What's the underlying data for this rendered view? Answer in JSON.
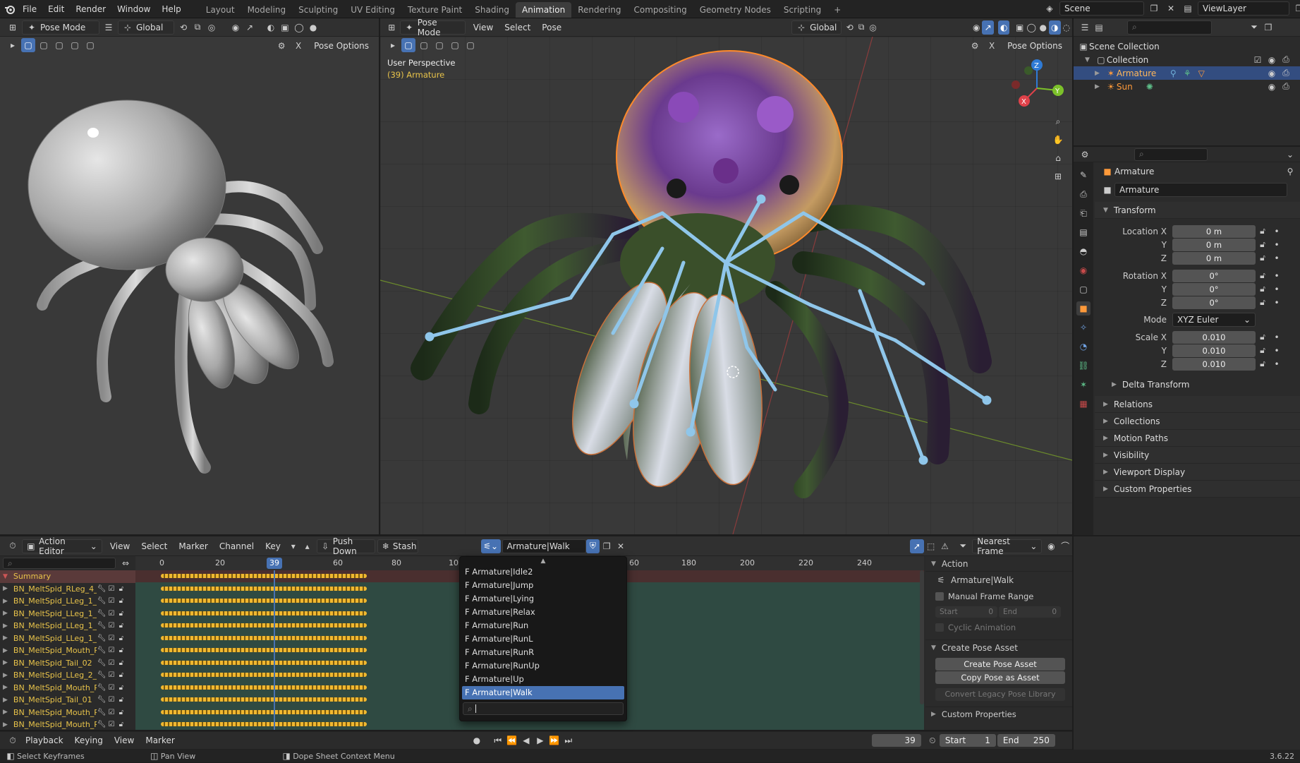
{
  "app": {
    "version": "3.6.22"
  },
  "topbar": {
    "menus": [
      "File",
      "Edit",
      "Render",
      "Window",
      "Help"
    ],
    "workspaces": [
      "Layout",
      "Modeling",
      "Sculpting",
      "UV Editing",
      "Texture Paint",
      "Shading",
      "Animation",
      "Rendering",
      "Compositing",
      "Geometry Nodes",
      "Scripting"
    ],
    "active_workspace": "Animation",
    "add_tab": "+",
    "scene": "Scene",
    "view_layer": "ViewLayer"
  },
  "left_view": {
    "mode": "Pose Mode",
    "orientation": "Global",
    "pose_options": "Pose Options"
  },
  "main_view": {
    "mode": "Pose Mode",
    "menus": [
      "View",
      "Select",
      "Pose"
    ],
    "orientation": "Global",
    "pose_options": "Pose Options",
    "overlay_title": "User Perspective",
    "overlay_subtitle": "(39) Armature",
    "gizmo": {
      "x": "X",
      "y": "Y",
      "z": "Z"
    }
  },
  "outliner": {
    "search_placeholder": "",
    "items": [
      {
        "label": "Scene Collection",
        "depth": 0
      },
      {
        "label": "Collection",
        "depth": 1
      },
      {
        "label": "Armature",
        "depth": 2,
        "selected": true
      },
      {
        "label": "Sun",
        "depth": 2,
        "selected": false
      }
    ]
  },
  "properties": {
    "object_name": "Armature",
    "datablock": "Armature",
    "transform_header": "Transform",
    "location": {
      "label": "Location X",
      "x": "0 m",
      "y": "0 m",
      "z": "0 m"
    },
    "rotation": {
      "label": "Rotation X",
      "x": "0°",
      "y": "0°",
      "z": "0°"
    },
    "mode_label": "Mode",
    "mode_value": "XYZ Euler",
    "scale": {
      "label": "Scale X",
      "x": "0.010",
      "y": "0.010",
      "z": "0.010"
    },
    "axis_y": "Y",
    "axis_z": "Z",
    "sections": [
      "Delta Transform",
      "Relations",
      "Collections",
      "Motion Paths",
      "Visibility",
      "Viewport Display",
      "Custom Properties"
    ]
  },
  "action_editor": {
    "mode": "Action Editor",
    "menus": [
      "View",
      "Select",
      "Marker",
      "Channel",
      "Key"
    ],
    "push_down": "Push Down",
    "stash": "Stash",
    "action_name": "Armature|Walk",
    "snap": "Nearest Frame",
    "current_frame": "39",
    "ruler_left": [
      "0",
      "20",
      "40",
      "60",
      "80",
      "10"
    ],
    "ruler_right": [
      "60",
      "180",
      "200",
      "220",
      "240"
    ],
    "summary": "Summary",
    "channels": [
      "BN_MeltSpid_RLeg_4_(",
      "BN_MeltSpid_LLeg_1_(",
      "BN_MeltSpid_LLeg_1_(",
      "BN_MeltSpid_LLeg_1_(",
      "BN_MeltSpid_LLeg_1_(",
      "BN_MeltSpid_Mouth_R",
      "BN_MeltSpid_Tail_02",
      "BN_MeltSpid_LLeg_2_(",
      "BN_MeltSpid_Mouth_R",
      "BN_MeltSpid_Tail_01",
      "BN_MeltSpid_Mouth_R",
      "BN_MeltSpid_Mouth_R"
    ],
    "popup": {
      "items": [
        "F Armature|Idle2",
        "F Armature|Jump",
        "F Armature|Lying",
        "F Armature|Relax",
        "F Armature|Run",
        "F Armature|RunL",
        "F Armature|RunR",
        "F Armature|RunUp",
        "F Armature|Up",
        "F Armature|Walk"
      ],
      "active": "F Armature|Walk",
      "search_value": ""
    },
    "sidebar": {
      "action_header": "Action",
      "action_name": "Armature|Walk",
      "manual_frame_range": "Manual Frame Range",
      "start_label": "Start",
      "start_value": "0",
      "end_label": "End",
      "end_value": "0",
      "cyclic": "Cyclic Animation",
      "create_pose_header": "Create Pose Asset",
      "create_pose_btn": "Create Pose Asset",
      "copy_pose_btn": "Copy Pose as Asset",
      "convert_btn": "Convert Legacy Pose Library",
      "custom_props": "Custom Properties"
    }
  },
  "timeline": {
    "menus": [
      "Playback",
      "Keying",
      "View",
      "Marker"
    ],
    "frame": "39",
    "start_label": "Start",
    "start": "1",
    "end_label": "End",
    "end": "250"
  },
  "statusbar": {
    "left": "Select Keyframes",
    "middle": "Pan View",
    "right": "Dope Sheet Context Menu",
    "version": "3.6.22"
  },
  "colors": {
    "accent": "#4772b3",
    "keyframe": "#f0b830",
    "bone": "#8fc6ea",
    "selection_outline": "#ff8a2a"
  }
}
